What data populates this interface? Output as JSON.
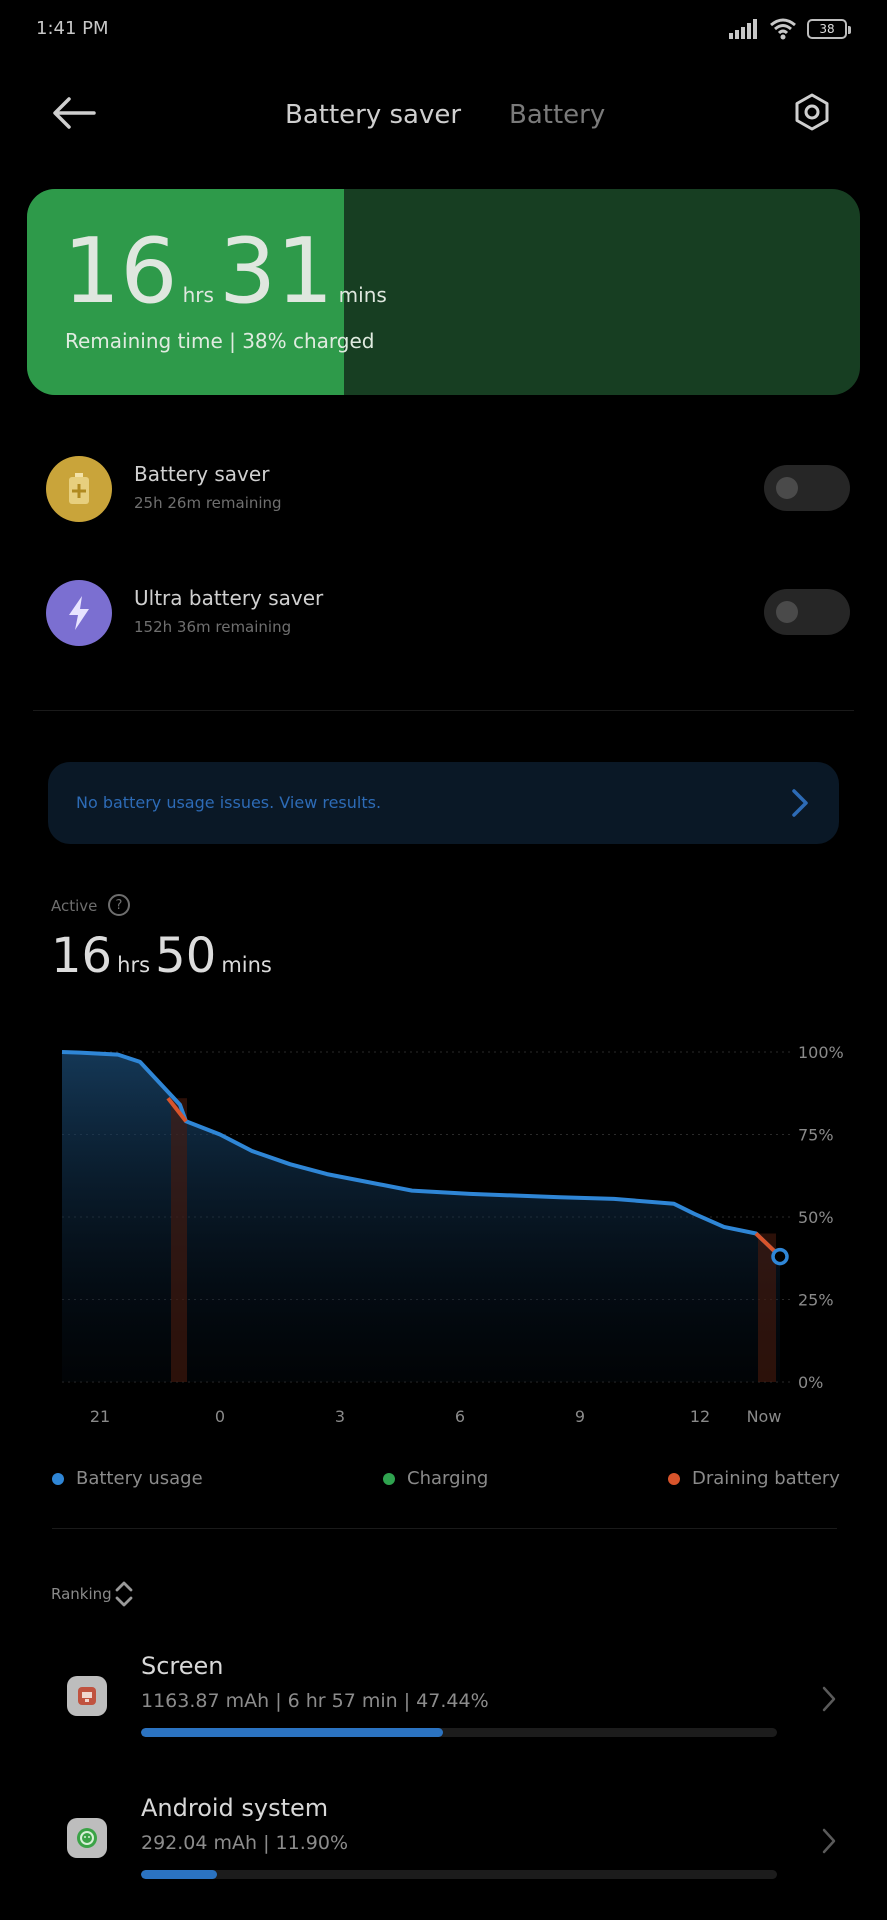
{
  "status_bar": {
    "time": "1:41 PM",
    "battery_level": "38"
  },
  "header": {
    "tabs": [
      {
        "label": "Battery saver",
        "active": true
      },
      {
        "label": "Battery",
        "active": false
      }
    ],
    "icons": {
      "back": "back-arrow-icon",
      "settings": "settings-icon"
    }
  },
  "remaining": {
    "hours": "16",
    "hours_unit": "hrs",
    "minutes": "31",
    "minutes_unit": "mins",
    "subtitle": "Remaining time | 38% charged",
    "charge_fraction": 0.38,
    "colors": {
      "fill": "#2e9a4a",
      "track": "#173e22"
    }
  },
  "savers": [
    {
      "title": "Battery saver",
      "subtitle": "25h 26m remaining",
      "icon": "battery-plus-icon",
      "icon_color": "#c9a43a",
      "enabled": false
    },
    {
      "title": "Ultra battery saver",
      "subtitle": "152h 36m remaining",
      "icon": "lightning-icon",
      "icon_color": "#7b6fd1",
      "enabled": false
    }
  ],
  "info_banner": {
    "text": "No battery usage issues. View results.",
    "icon": "chevron-right-icon"
  },
  "active": {
    "label": "Active",
    "hours": "16",
    "hours_unit": "hrs",
    "minutes": "50",
    "minutes_unit": "mins"
  },
  "chart_data": {
    "type": "area",
    "x_tick_labels": [
      "21",
      "0",
      "3",
      "6",
      "9",
      "12",
      "Now"
    ],
    "y_tick_labels": [
      "100%",
      "75%",
      "50%",
      "25%",
      "0%"
    ],
    "ylim": [
      0,
      100
    ],
    "xlim": [
      20.5,
      13.6
    ],
    "x": [
      20.5,
      20.8,
      21.7,
      22.2,
      23.2,
      23.7,
      24.5,
      25.3,
      26.2,
      26.9,
      30,
      33,
      36,
      34.2,
      35.0,
      35.6,
      36.4,
      37.0,
      37.4
    ],
    "values": [
      100,
      99.8,
      99.2,
      97,
      84,
      79,
      75,
      70,
      66,
      63,
      58,
      57,
      56,
      55.5,
      54,
      51,
      47,
      45,
      38
    ],
    "grid": true,
    "legend": [
      {
        "name": "Battery usage",
        "color": "#2f86d6"
      },
      {
        "name": "Charging",
        "color": "#2fa34f"
      },
      {
        "name": "Draining battery",
        "color": "#d8542b"
      }
    ]
  },
  "ranking": {
    "label": "Ranking",
    "items": [
      {
        "name": "Screen",
        "stats": "1163.87 mAh | 6 hr 57 min  | 47.44%",
        "fraction": 0.4744,
        "icon": "screen-app-icon"
      },
      {
        "name": "Android system",
        "stats": "292.04 mAh | 11.90%",
        "fraction": 0.119,
        "icon": "android-system-icon"
      }
    ]
  }
}
